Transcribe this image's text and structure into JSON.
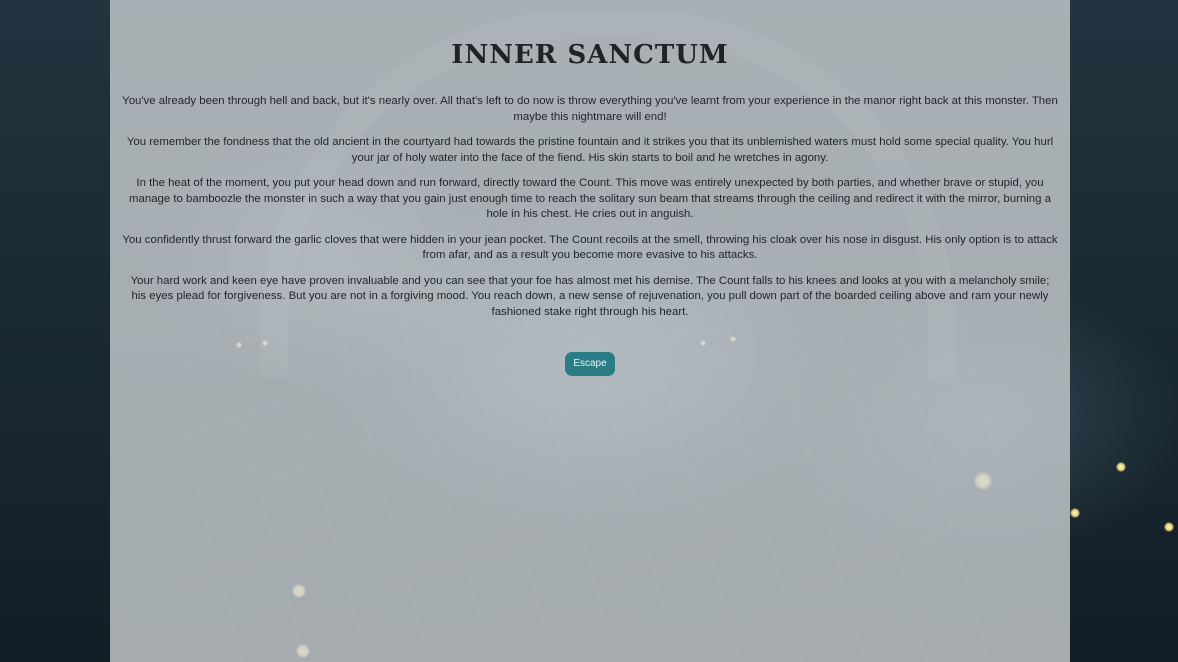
{
  "scene": {
    "title": "INNER SANCTUM",
    "paragraphs": [
      "You've already been through hell and back, but it's nearly over. All that's left to do now is throw everything you've learnt from your experience in the manor right back at this monster. Then maybe this nightmare will end!",
      "You remember the fondness that the old ancient in the courtyard had towards the pristine fountain and it strikes you that its unblemished waters must hold some special quality. You hurl your jar of holy water into the face of the fiend. His skin starts to boil and he wretches in agony.",
      "In the heat of the moment, you put your head down and run forward, directly toward the Count. This move was entirely unexpected by both parties, and whether brave or stupid, you manage to bamboozle the monster in such a way that you gain just enough time to reach the solitary sun beam that streams through the ceiling and redirect it with the mirror, burning a hole in his chest. He cries out in anguish.",
      "You confidently thrust forward the garlic cloves that were hidden in your jean pocket. The Count recoils at the smell, throwing his cloak over his nose in disgust. His only option is to attack from afar, and as a result you become more evasive to his attacks.",
      "Your hard work and keen eye have proven invaluable and you can see that your foe has almost met his demise. The Count falls to his knees and looks at you with a melancholy smile; his eyes plead for forgiveness. But you are not in a forgiving mood. You reach down, a new sense of rejuvenation, you pull down part of the boarded ceiling above and ram your newly fashioned stake right through his heart."
    ],
    "escape_label": "Escape"
  },
  "colors": {
    "panel_overlay": "#ced4d6",
    "button_bg": "#2a7d84",
    "button_text": "#e8f4f4",
    "text": "#22262a"
  }
}
